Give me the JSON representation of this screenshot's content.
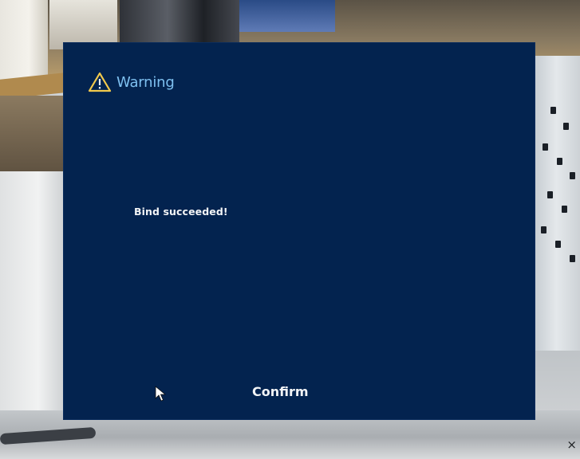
{
  "dialog": {
    "title": "Warning",
    "title_icon": "warning-triangle-icon",
    "message": "Bind succeeded!",
    "confirm_label": "Confirm"
  },
  "overlay": {
    "close_glyph": "×",
    "cursor_icon": "mouse-pointer-icon"
  },
  "colors": {
    "dialog_background": "#03234f",
    "title_text": "#7ec0f0",
    "body_text": "#f2f4f6",
    "warning_icon": "#f2c94c"
  }
}
